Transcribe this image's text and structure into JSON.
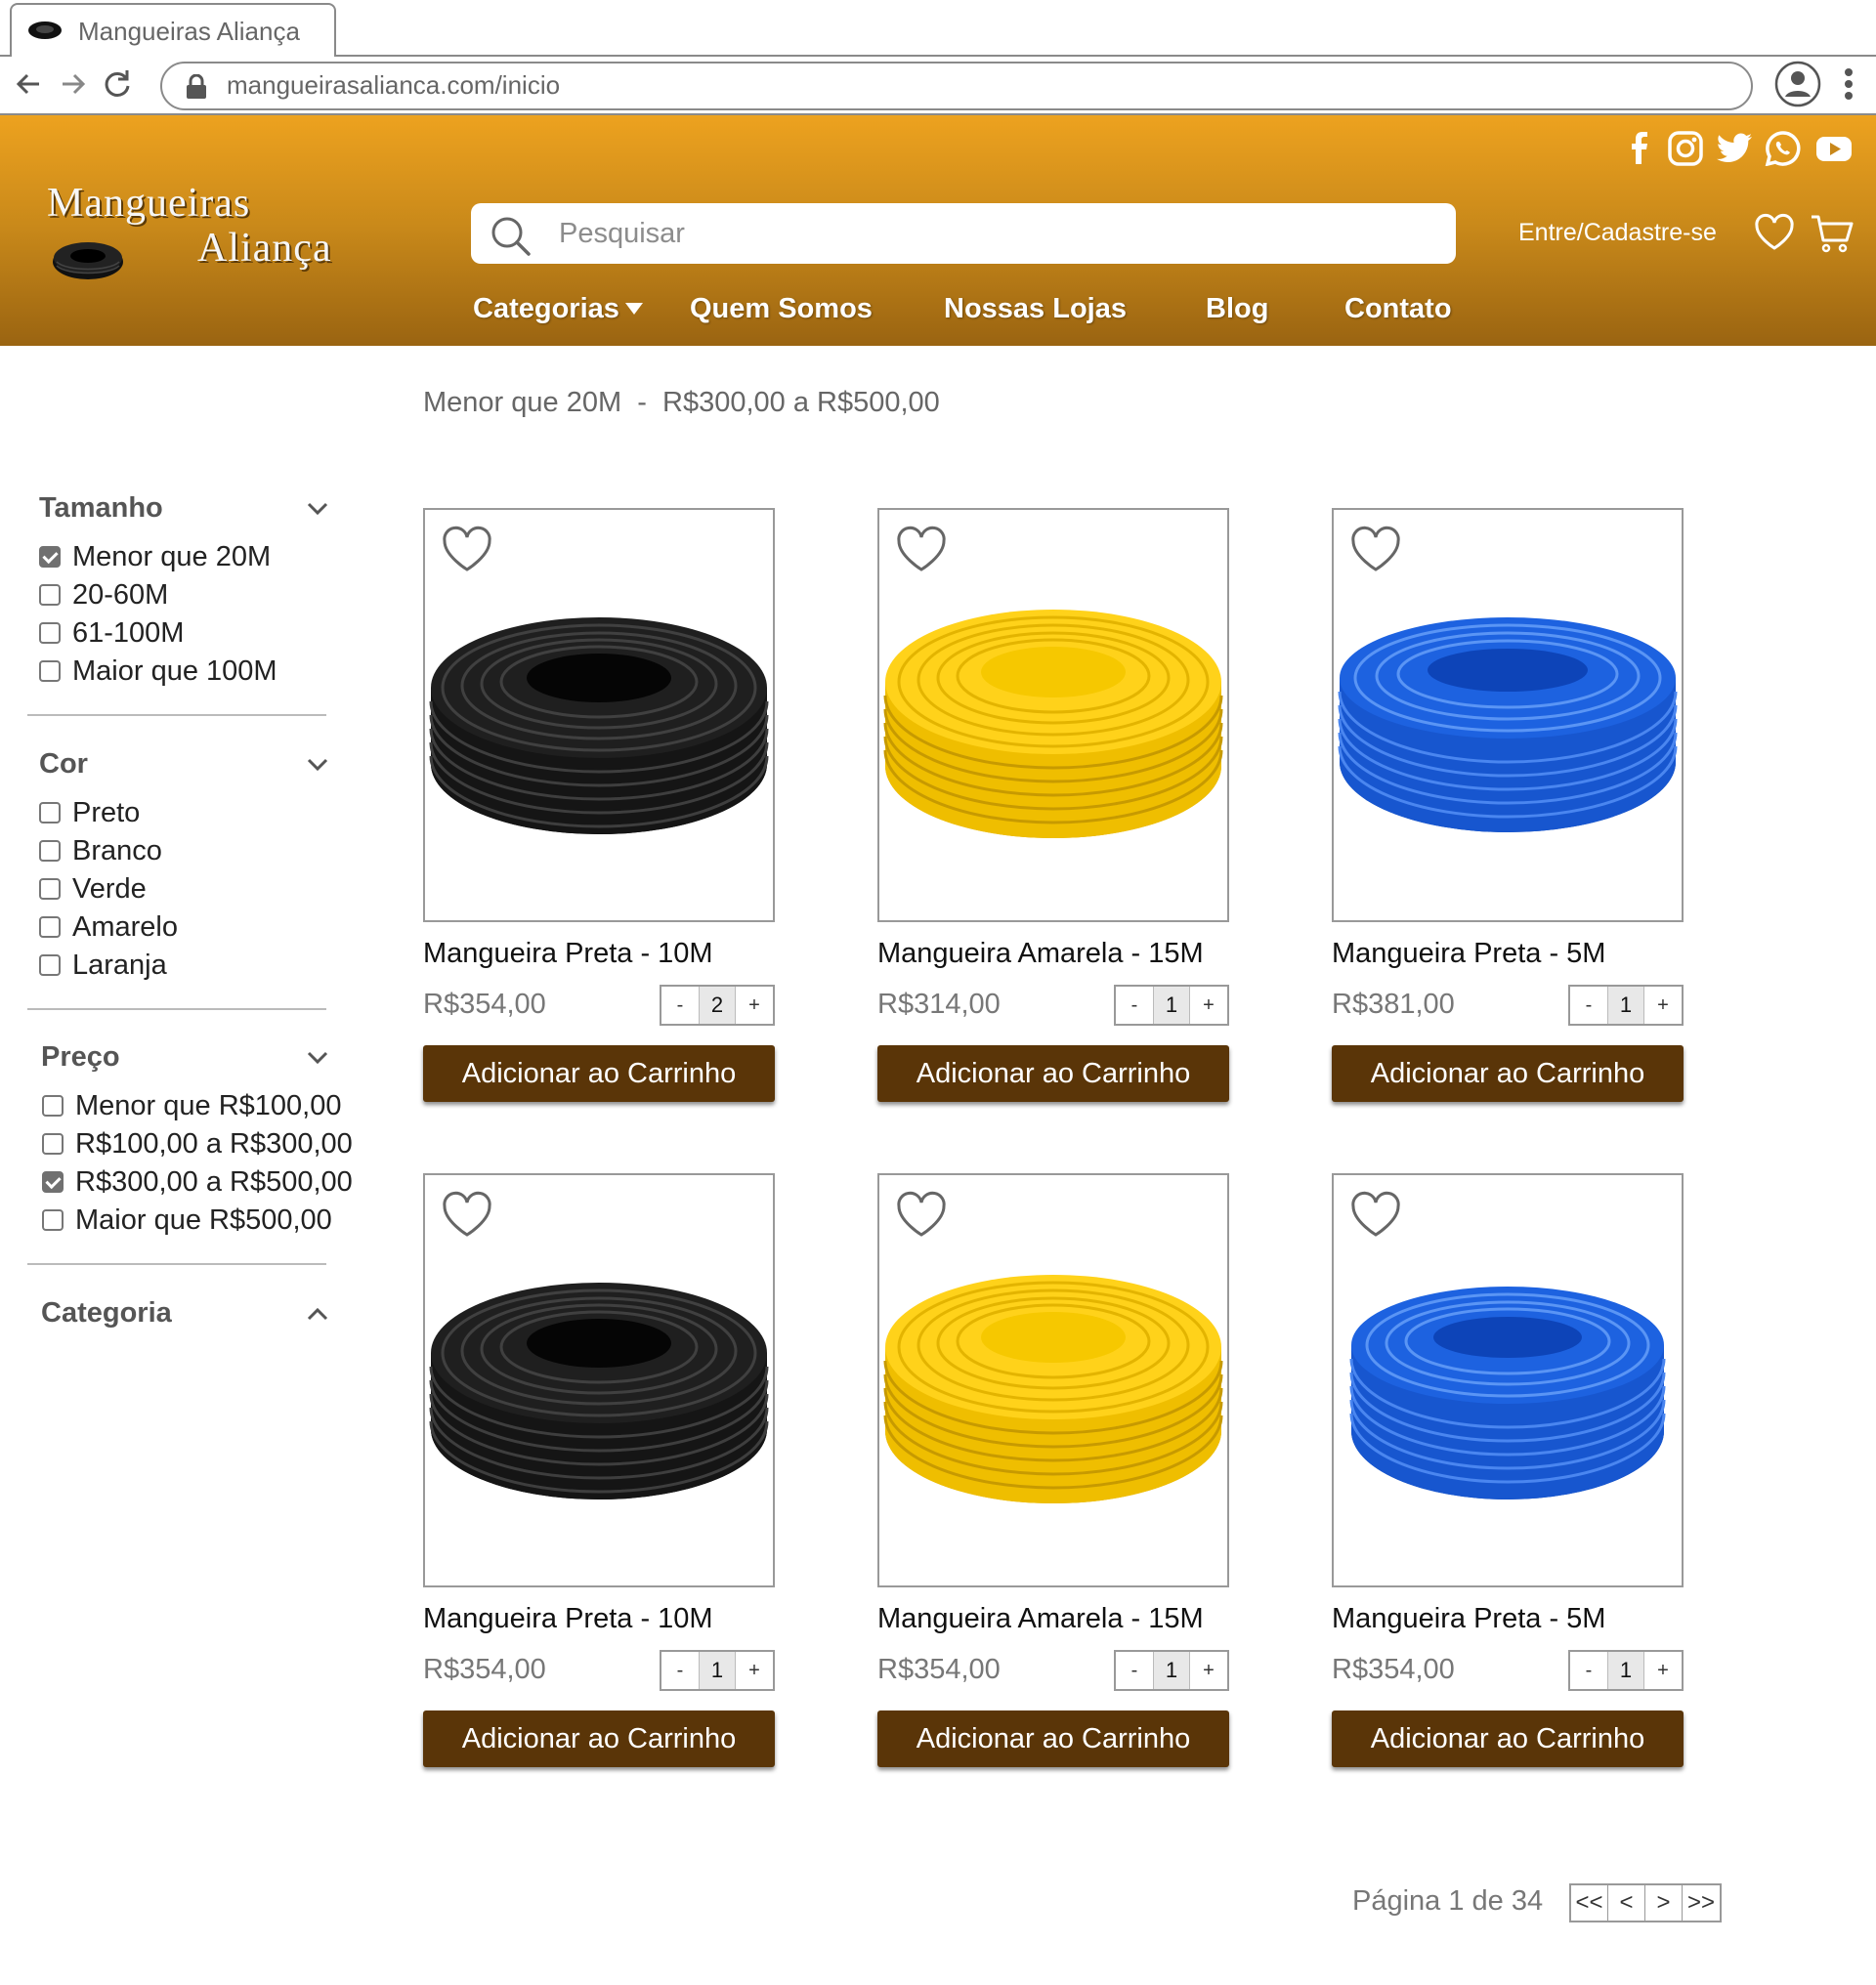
{
  "browser": {
    "tab_title": "Mangueiras Aliança",
    "url": "mangueirasalianca.com/inicio"
  },
  "header": {
    "logo_line1": "Mangueiras",
    "logo_line2": "Aliança",
    "search_placeholder": "Pesquisar",
    "login_label": "Entre/Cadastre-se",
    "social": [
      "facebook-icon",
      "instagram-icon",
      "twitter-icon",
      "whatsapp-icon",
      "youtube-icon"
    ],
    "nav": {
      "categorias": "Categorias",
      "quem_somos": "Quem Somos",
      "nossas_lojas": "Nossas Lojas",
      "blog": "Blog",
      "contato": "Contato"
    }
  },
  "active_filters": "Menor que 20M  -  R$300,00 a R$500,00",
  "sidebar": {
    "tamanho": {
      "title": "Tamanho",
      "options": [
        {
          "label": "Menor que 20M",
          "checked": true
        },
        {
          "label": "20-60M",
          "checked": false
        },
        {
          "label": "61-100M",
          "checked": false
        },
        {
          "label": "Maior que 100M",
          "checked": false
        }
      ]
    },
    "cor": {
      "title": "Cor",
      "options": [
        {
          "label": "Preto",
          "checked": false
        },
        {
          "label": "Branco",
          "checked": false
        },
        {
          "label": "Verde",
          "checked": false
        },
        {
          "label": "Amarelo",
          "checked": false
        },
        {
          "label": "Laranja",
          "checked": false
        }
      ]
    },
    "preco": {
      "title": "Preço",
      "options": [
        {
          "label": "Menor que R$100,00",
          "checked": false
        },
        {
          "label": "R$100,00 a R$300,00",
          "checked": false
        },
        {
          "label": "R$300,00 a R$500,00",
          "checked": true
        },
        {
          "label": "Maior que R$500,00",
          "checked": false
        }
      ]
    },
    "categoria": {
      "title": "Categoria"
    }
  },
  "products": [
    {
      "name": "Mangueira Preta - 10M",
      "price": "R$354,00",
      "qty": "2",
      "color": "#1f1f1f"
    },
    {
      "name": "Mangueira Amarela - 15M",
      "price": "R$314,00",
      "qty": "1",
      "color": "#f5c400"
    },
    {
      "name": "Mangueira Preta - 5M",
      "price": "R$381,00",
      "qty": "1",
      "color": "#1c5fd6"
    },
    {
      "name": "Mangueira Preta - 10M",
      "price": "R$354,00",
      "qty": "1",
      "color": "#1f1f1f"
    },
    {
      "name": "Mangueira Amarela - 15M",
      "price": "R$354,00",
      "qty": "1",
      "color": "#f5c400"
    },
    {
      "name": "Mangueira Preta - 5M",
      "price": "R$354,00",
      "qty": "1",
      "color": "#1c5fd6"
    }
  ],
  "product_ui": {
    "minus": "-",
    "plus": "+",
    "add_to_cart": "Adicionar ao Carrinho"
  },
  "pagination": {
    "info": "Página 1 de 34",
    "first": "<<",
    "prev": "<",
    "next": ">",
    "last": ">>"
  }
}
